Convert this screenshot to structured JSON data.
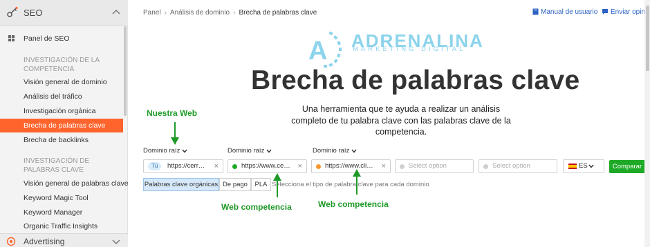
{
  "sidebar": {
    "section_title": "SEO",
    "items": [
      {
        "label": "Panel de SEO"
      },
      {
        "group": "INVESTIGACIÓN DE LA COMPETENCIA"
      },
      {
        "label": "Visión general de dominio"
      },
      {
        "label": "Análisis del tráfico"
      },
      {
        "label": "Investigación orgánica"
      },
      {
        "label": "Brecha de palabras clave",
        "active": true
      },
      {
        "label": "Brecha de backlinks"
      },
      {
        "group": "INVESTIGACIÓN DE PALABRAS CLAVE"
      },
      {
        "label": "Visión general de palabras clave"
      },
      {
        "label": "Keyword Magic Tool"
      },
      {
        "label": "Keyword Manager"
      },
      {
        "label": "Organic Traffic Insights"
      }
    ],
    "footer_section": "Advertising",
    "accent_color": "#ff642d"
  },
  "breadcrumb": [
    "Panel",
    "Análisis de dominio",
    "Brecha de palabras clave"
  ],
  "top_links": {
    "manual": "Manual de usuario",
    "feedback": "Enviar opinió"
  },
  "logo": {
    "name": "ADRENALINA",
    "tagline": "MARKETING DIGITAL",
    "mark_letter": "A",
    "color": "#8cd3ec"
  },
  "page_title": "Brecha de palabras clave",
  "page_subtitle": "Una herramienta que te ayuda a realizar un análisis completo de tu palabra clave con las palabras clave de la competencia.",
  "annotations": {
    "ours": "Nuestra Web",
    "competitor1": "Web competencia",
    "competitor2": "Web competencia",
    "color": "#1f9a28"
  },
  "domain_row": {
    "labels": [
      "Dominio raíz",
      "Dominio raíz",
      "Dominio raíz"
    ],
    "fields": [
      {
        "badge": "Tú",
        "value": "https://cerr…"
      },
      {
        "dot_color": "#1eaa26",
        "value": "https://www.ce…"
      },
      {
        "dot_color": "#f7962b",
        "value": "https://www.cli…"
      },
      {
        "placeholder": "Select option"
      },
      {
        "placeholder": "Select option"
      }
    ],
    "database": "ES",
    "compare_label": "Comparar"
  },
  "keyword_types": {
    "tabs": [
      "Palabras clave orgánicas",
      "De pago",
      "PLA"
    ],
    "selected": 0,
    "hint": "Selecciona el tipo de palabra clave para cada dominio"
  }
}
